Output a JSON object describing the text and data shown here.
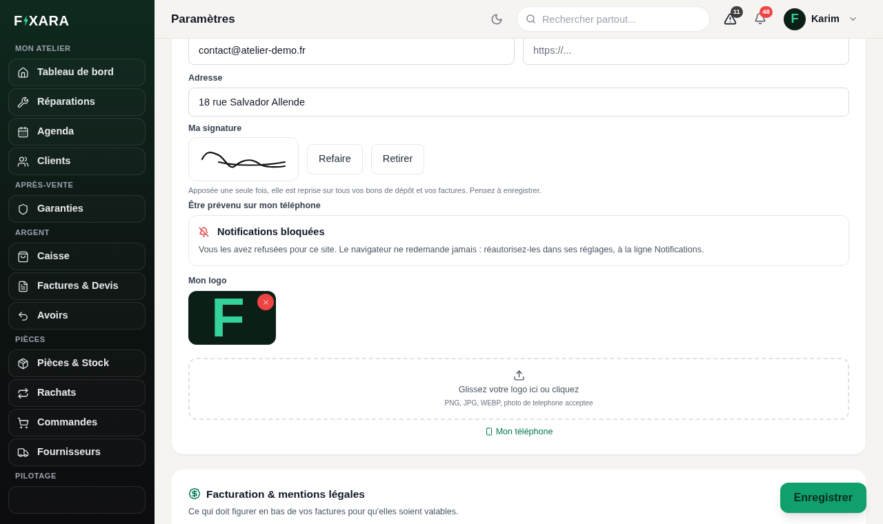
{
  "brand": {
    "before": "F",
    "after": "XARA"
  },
  "sidebar": {
    "sections": [
      {
        "title": "MON ATELIER",
        "items": [
          {
            "label": "Tableau de bord"
          },
          {
            "label": "Réparations"
          },
          {
            "label": "Agenda"
          },
          {
            "label": "Clients"
          }
        ]
      },
      {
        "title": "APRÈS-VENTE",
        "items": [
          {
            "label": "Garanties"
          }
        ]
      },
      {
        "title": "ARGENT",
        "items": [
          {
            "label": "Caisse"
          },
          {
            "label": "Factures & Devis"
          },
          {
            "label": "Avoirs"
          }
        ]
      },
      {
        "title": "PIÈCES",
        "items": [
          {
            "label": "Pièces & Stock"
          },
          {
            "label": "Rachats"
          },
          {
            "label": "Commandes"
          },
          {
            "label": "Fournisseurs"
          }
        ]
      },
      {
        "title": "PILOTAGE"
      }
    ]
  },
  "header": {
    "title": "Paramètres",
    "search": {
      "placeholder": "Rechercher partout..."
    },
    "alerts_count": "11",
    "notifications_count": "48",
    "user": {
      "initial": "F",
      "name": "Karim"
    }
  },
  "form": {
    "email_value": "contact@atelier-demo.fr",
    "website_placeholder": "https://...",
    "address": {
      "label": "Adresse",
      "value": "18 rue Salvador Allende"
    },
    "signature": {
      "label": "Ma signature",
      "buttons": [
        "Refaire",
        "Retirer"
      ],
      "hint": "Apposée une seule fois, elle est reprise sur tous vos bons de dépôt et vos factures. Pensez à enregistrer."
    },
    "phone": {
      "label": "Être prévenu sur mon téléphone",
      "title": "Notifications bloquées",
      "text": "Vous les avez refusées pour ce site. Le navigateur ne redemande jamais : réautorisez-les dans ses réglages, à la ligne Notifications."
    },
    "logo": {
      "label": "Mon logo",
      "letter": "F",
      "drop_title": "Glissez votre logo ici ou cliquez",
      "drop_hint": "PNG, JPG, WEBP, photo de telephone acceptee",
      "phone_link": "Mon téléphone"
    }
  },
  "billing": {
    "title": "Facturation & mentions légales",
    "subtitle": "Ce qui doit figurer en bas de vos factures pour qu'elles soient valables."
  },
  "save_button": "Enregistrer"
}
